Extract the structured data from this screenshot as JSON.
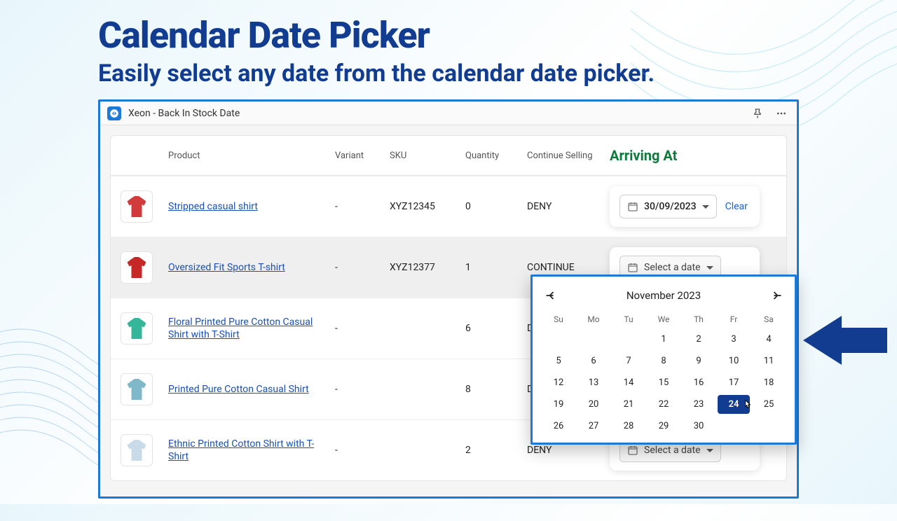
{
  "headline": {
    "title": "Calendar Date Picker",
    "subtitle": "Easily select any date from the calendar date picker."
  },
  "titlebar": {
    "app_name": "Xeon - Back In Stock Date"
  },
  "columns": {
    "product": "Product",
    "variant": "Variant",
    "sku": "SKU",
    "quantity": "Quantity",
    "continue": "Continue Selling",
    "arriving": "Arriving At"
  },
  "buttons": {
    "select_date": "Select a date",
    "clear": "Clear"
  },
  "rows": [
    {
      "name": "Stripped casual shirt",
      "variant": "-",
      "sku": "XYZ12345",
      "qty": "0",
      "cont": "DENY",
      "date": "30/09/2023",
      "color": "#d23b3b"
    },
    {
      "name": "Oversized Fit Sports T-shirt",
      "variant": "-",
      "sku": "XYZ12377",
      "qty": "1",
      "cont": "CONTINUE",
      "date": "",
      "color": "#c62828"
    },
    {
      "name": "Floral Printed Pure Cotton Casual Shirt with T-Shirt",
      "variant": "-",
      "sku": "",
      "qty": "6",
      "cont": "DE",
      "date": "",
      "color": "#35b59a"
    },
    {
      "name": "Printed Pure Cotton Casual Shirt",
      "variant": "-",
      "sku": "",
      "qty": "8",
      "cont": "DE",
      "date": "",
      "color": "#7fb9c9"
    },
    {
      "name": "Ethnic Printed Cotton Shirt with T-Shirt",
      "variant": "-",
      "sku": "",
      "qty": "2",
      "cont": "DENY",
      "date": "",
      "color": "#c9dbe8"
    }
  ],
  "calendar": {
    "title": "November 2023",
    "dow": [
      "Su",
      "Mo",
      "Tu",
      "We",
      "Th",
      "Fr",
      "Sa"
    ],
    "leading_blanks": 3,
    "days": 30,
    "selected": 24
  }
}
